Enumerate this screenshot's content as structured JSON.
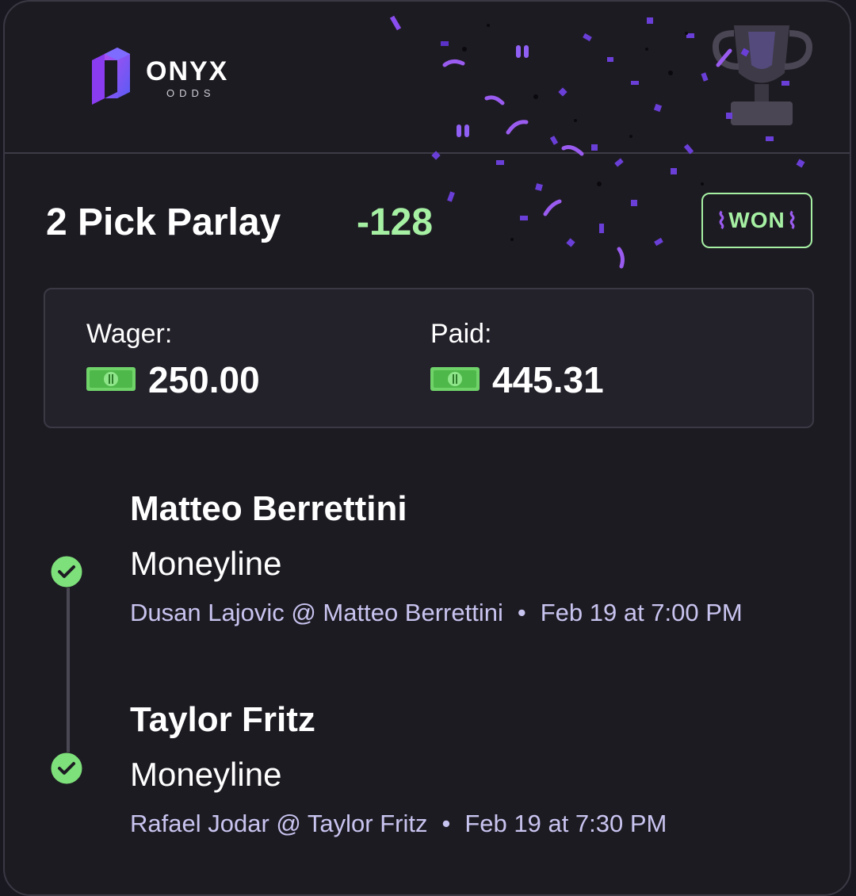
{
  "brand": {
    "name": "ONYX",
    "sub": "ODDS"
  },
  "bet": {
    "title": "2 Pick Parlay",
    "odds": "-128",
    "status": "WON"
  },
  "wager": {
    "label": "Wager:",
    "amount": "250.00"
  },
  "paid": {
    "label": "Paid:",
    "amount": "445.31"
  },
  "legs": [
    {
      "player": "Matteo Berrettini",
      "market": "Moneyline",
      "matchup": "Dusan Lajovic @ Matteo Berrettini",
      "separator": "•",
      "time": "Feb 19 at 7:00 PM",
      "result_icon": "check-icon"
    },
    {
      "player": "Taylor Fritz",
      "market": "Moneyline",
      "matchup": "Rafael Jodar @ Taylor Fritz",
      "separator": "•",
      "time": "Feb 19 at 7:30 PM",
      "result_icon": "check-icon"
    }
  ],
  "colors": {
    "accent_green": "#a6f0a4",
    "accent_purple": "#9b5cf0",
    "meta_text": "#c8c4f0",
    "background": "#1d1b22"
  },
  "icons": {
    "logo": "onyx-logo-icon",
    "currency": "money-bill-icon",
    "trophy": "trophy-icon",
    "confetti": "confetti-icon"
  }
}
